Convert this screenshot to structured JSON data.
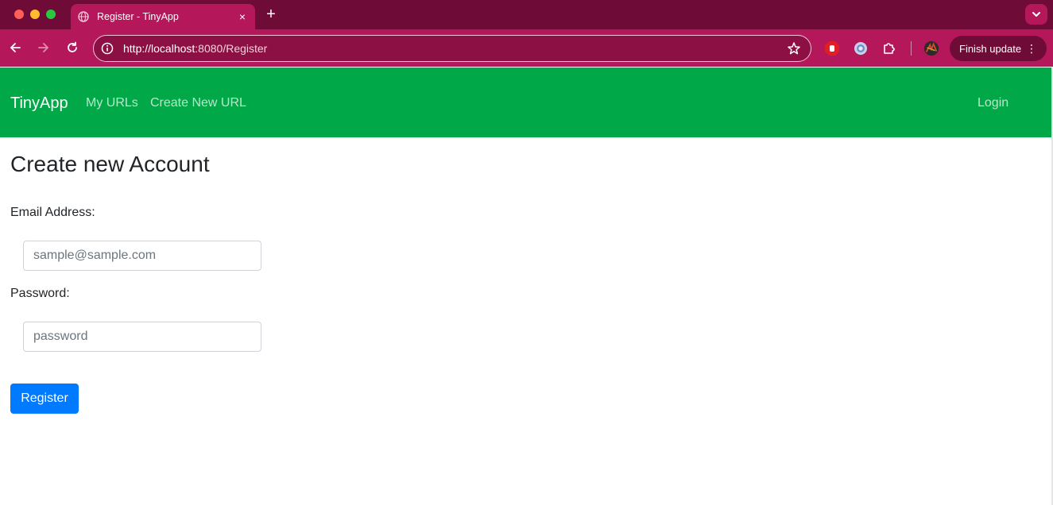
{
  "browser": {
    "tab_title": "Register - TinyApp",
    "tab_close": "×",
    "new_tab": "+",
    "url_host": "http://localhost",
    "url_rest": ":8080/Register",
    "finish_update_label": "Finish update",
    "menu_dots": "⋮",
    "colors": {
      "frame": "#6f0b37",
      "toolbar": "#b4175a"
    }
  },
  "navbar": {
    "brand": "TinyApp",
    "links": [
      "My URLs",
      "Create New URL"
    ],
    "login": "Login",
    "color": "#00a847"
  },
  "form": {
    "title": "Create new Account",
    "email_label": "Email Address:",
    "email_placeholder": "sample@sample.com",
    "email_value": "",
    "password_label": "Password:",
    "password_placeholder": "password",
    "password_value": "",
    "submit_label": "Register",
    "submit_color": "#007bff"
  }
}
